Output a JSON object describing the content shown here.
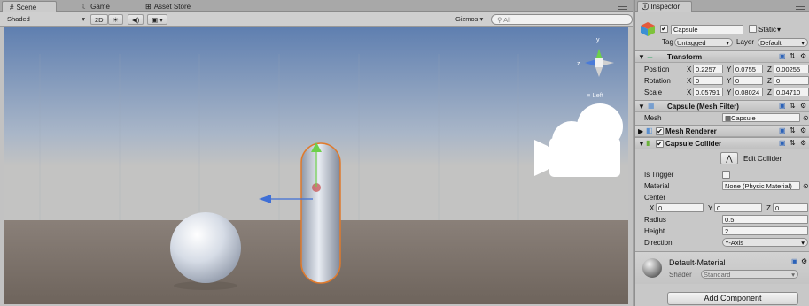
{
  "scene_tabs": [
    {
      "label": "Scene",
      "icon": "scene-icon"
    },
    {
      "label": "Game",
      "icon": "game-icon"
    },
    {
      "label": "Asset Store",
      "icon": "asset-store-icon"
    }
  ],
  "scene_toolbar": {
    "shading": "Shaded",
    "mode_2d": "2D",
    "gizmos": "Gizmos",
    "search_placeholder": "All"
  },
  "viewport": {
    "gizmo_label": "Left"
  },
  "inspector": {
    "tab_label": "Inspector",
    "object_name": "Capsule",
    "static_label": "Static",
    "tag_label": "Tag",
    "tag_value": "Untagged",
    "layer_label": "Layer",
    "layer_value": "Default",
    "transform": {
      "title": "Transform",
      "position_label": "Position",
      "rotation_label": "Rotation",
      "scale_label": "Scale",
      "position": {
        "x": "0.2257",
        "y": "0.0755",
        "z": "0.00255"
      },
      "rotation": {
        "x": "0",
        "y": "0",
        "z": "0"
      },
      "scale": {
        "x": "0.05791",
        "y": "0.08024",
        "z": "0.04710"
      }
    },
    "mesh_filter": {
      "title": "Capsule (Mesh Filter)",
      "mesh_label": "Mesh",
      "mesh_value": "Capsule"
    },
    "mesh_renderer": {
      "title": "Mesh Renderer"
    },
    "capsule_collider": {
      "title": "Capsule Collider",
      "edit_label": "Edit Collider",
      "is_trigger_label": "Is Trigger",
      "material_label": "Material",
      "material_value": "None (Physic Material)",
      "center_label": "Center",
      "center": {
        "x": "0",
        "y": "0",
        "z": "0"
      },
      "radius_label": "Radius",
      "radius_value": "0.5",
      "height_label": "Height",
      "height_value": "2",
      "direction_label": "Direction",
      "direction_value": "Y-Axis"
    },
    "material": {
      "name": "Default-Material",
      "shader_label": "Shader",
      "shader_value": "Standard"
    },
    "add_component": "Add Component"
  }
}
